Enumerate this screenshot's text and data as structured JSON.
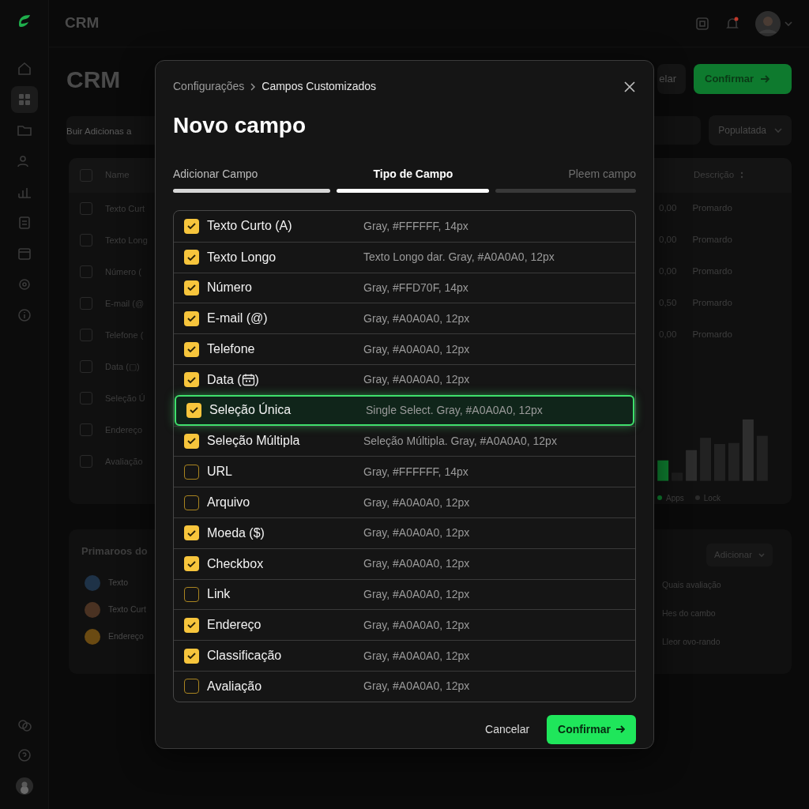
{
  "topbar": {
    "title": "CRM",
    "has_notification": true
  },
  "sidebar": {
    "nav_items": [
      {
        "selected": false
      },
      {
        "selected": true
      },
      {
        "selected": false
      },
      {
        "selected": false
      },
      {
        "selected": false
      },
      {
        "selected": false
      },
      {
        "selected": false
      },
      {
        "selected": false
      },
      {
        "selected": false
      }
    ]
  },
  "page": {
    "title": "CRM",
    "cancel_button": "elar",
    "confirm_button": "Confirmar",
    "search_placeholder": "Buir Adicionas a",
    "sort_dropdown": "Populatada"
  },
  "table": {
    "columns": [
      "Name",
      "Descrição"
    ],
    "header_checked": false,
    "rows": [
      {
        "name": "Texto Curt",
        "value": "0,00",
        "description": "Promardo",
        "checked": false
      },
      {
        "name": "Texto Long",
        "value": "0,00",
        "description": "Promardo",
        "checked": false
      },
      {
        "name": "Número (",
        "value": "0,00",
        "description": "Promardo",
        "checked": false
      },
      {
        "name": "E-mail (@",
        "value": "0,50",
        "description": "Promardo",
        "checked": false
      },
      {
        "name": "Telefone (",
        "value": "0,00",
        "description": "Promardo",
        "checked": false
      },
      {
        "name": "Data (▢)",
        "checked": false
      },
      {
        "name": "Seleção Ú",
        "checked": false
      },
      {
        "name": "Endereço",
        "checked": false
      },
      {
        "name": "Avaliação",
        "checked": false
      }
    ],
    "legend": [
      "Apps",
      "Lock"
    ]
  },
  "summary_card": {
    "title": "Primaroos do",
    "items": [
      {
        "label": "Texto",
        "color": "#1e3247"
      },
      {
        "label": "Texto Curt",
        "color": "#4a3222"
      },
      {
        "label": "Endereço",
        "color": "#6a4a12"
      }
    ],
    "add_button": "Adicionar",
    "notes": [
      "Quais avaliação",
      "Hes do cambo",
      "Lleor ovo-rando"
    ]
  },
  "modal": {
    "breadcrumb": [
      "Configurações",
      "Campos Customizados"
    ],
    "title": "Novo campo",
    "steps": [
      {
        "label": "Adicionar Campo",
        "completed": true,
        "selected": false
      },
      {
        "label": "Tipo de Campo",
        "completed": false,
        "selected": true
      },
      {
        "label": "Pleem campo",
        "completed": false,
        "selected": false
      }
    ],
    "fields": [
      {
        "label": "Texto Curto (A)",
        "description": "Gray, #FFFFFF, 14px",
        "checked": true,
        "selected": false
      },
      {
        "label": "Texto Longo",
        "description": "Texto Longo dar. Gray, #A0A0A0, 12px",
        "checked": true,
        "selected": false
      },
      {
        "label": "Número",
        "description": "Gray, #FFD70F, 14px",
        "checked": true,
        "selected": false
      },
      {
        "label": "E-mail (@)",
        "description": "Gray, #A0A0A0, 12px",
        "checked": true,
        "selected": false
      },
      {
        "label": "Telefone",
        "description": "Gray, #A0A0A0, 12px",
        "checked": true,
        "selected": false
      },
      {
        "label": "Data (",
        "label_after_icon": ")",
        "description": "Gray, #A0A0A0, 12px",
        "checked": true,
        "selected": false
      },
      {
        "label": "Seleção Única",
        "description": "Single Select. Gray, #A0A0A0, 12px",
        "checked": true,
        "selected": true
      },
      {
        "label": "Seleção Múltipla",
        "description": "Seleção Múltipla. Gray, #A0A0A0, 12px",
        "checked": true,
        "selected": false
      },
      {
        "label": "URL",
        "description": "Gray, #FFFFFF, 14px",
        "checked": false,
        "selected": false
      },
      {
        "label": "Arquivo",
        "description": "Gray, #A0A0A0, 12px",
        "checked": false,
        "selected": false
      },
      {
        "label": "Moeda ($)",
        "description": "Gray, #A0A0A0, 12px",
        "checked": true,
        "selected": false
      },
      {
        "label": "Checkbox",
        "description": "Gray, #A0A0A0, 12px",
        "checked": true,
        "selected": false
      },
      {
        "label": "Link",
        "description": "Gray, #A0A0A0, 12px",
        "checked": false,
        "selected": false
      },
      {
        "label": "Endereço",
        "description": "Gray, #A0A0A0, 12px",
        "checked": true,
        "selected": false
      },
      {
        "label": "Classificação",
        "description": "Gray, #A0A0A0, 12px",
        "checked": true,
        "selected": false
      },
      {
        "label": "Avaliação",
        "description": "Gray, #A0A0A0, 12px",
        "checked": false,
        "selected": false
      }
    ],
    "cancel_button": "Cancelar",
    "confirm_button": "Confirmar"
  }
}
